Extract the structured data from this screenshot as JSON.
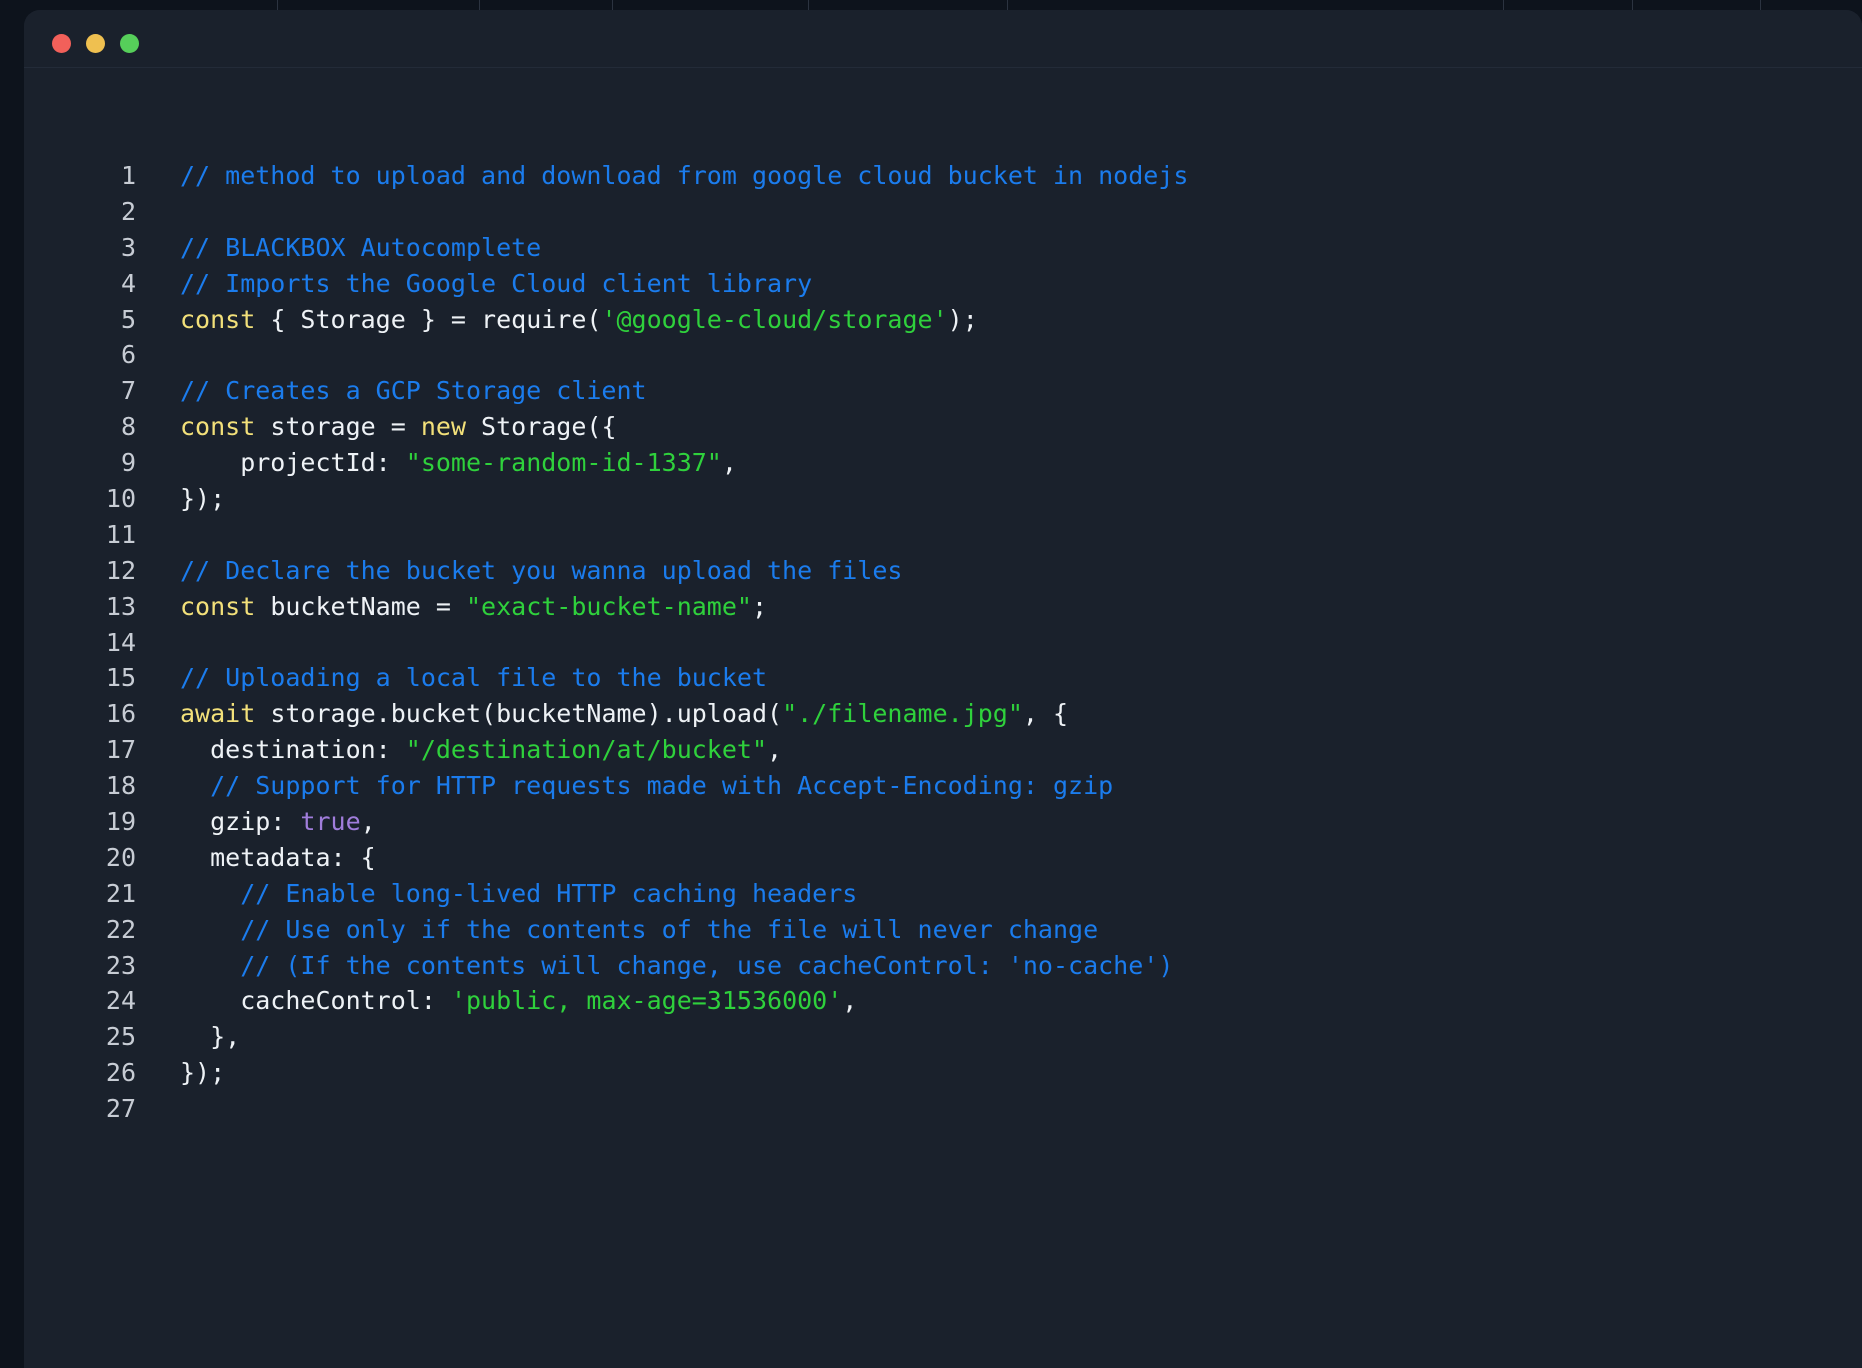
{
  "window": {
    "title": "",
    "traffic_lights": [
      {
        "name": "close",
        "color": "#f2605a"
      },
      {
        "name": "minimize",
        "color": "#efc050"
      },
      {
        "name": "maximize",
        "color": "#56cf5a"
      }
    ]
  },
  "theme": {
    "outer_background": "#0d131c",
    "window_background": "#1a212c",
    "divider": "#232b38",
    "line_number": "#c7ccd4",
    "comment": "#1b7ced",
    "keyword": "#f2e07a",
    "string": "#2fd13c",
    "boolean": "#a07ddb",
    "plain_text": "#eef2f6"
  },
  "editor": {
    "language": "javascript",
    "first_line": 1,
    "last_line": 27,
    "lines": [
      {
        "n": "1",
        "tokens": [
          {
            "t": "comment",
            "v": "// method to upload and download from google cloud bucket in nodejs"
          }
        ]
      },
      {
        "n": "2",
        "tokens": []
      },
      {
        "n": "3",
        "tokens": [
          {
            "t": "comment",
            "v": "// BLACKBOX Autocomplete"
          }
        ]
      },
      {
        "n": "4",
        "tokens": [
          {
            "t": "comment",
            "v": "// Imports the Google Cloud client library"
          }
        ]
      },
      {
        "n": "5",
        "tokens": [
          {
            "t": "kw",
            "v": "const"
          },
          {
            "t": "plain",
            "v": " { Storage } = require("
          },
          {
            "t": "str",
            "v": "'@google-cloud/storage'"
          },
          {
            "t": "plain",
            "v": ");"
          }
        ]
      },
      {
        "n": "6",
        "tokens": []
      },
      {
        "n": "7",
        "tokens": [
          {
            "t": "comment",
            "v": "// Creates a GCP Storage client"
          }
        ]
      },
      {
        "n": "8",
        "tokens": [
          {
            "t": "kw",
            "v": "const"
          },
          {
            "t": "plain",
            "v": " storage = "
          },
          {
            "t": "kw",
            "v": "new"
          },
          {
            "t": "plain",
            "v": " Storage({"
          }
        ]
      },
      {
        "n": "9",
        "tokens": [
          {
            "t": "plain",
            "v": "    projectId: "
          },
          {
            "t": "str",
            "v": "\"some-random-id-1337\""
          },
          {
            "t": "plain",
            "v": ","
          }
        ]
      },
      {
        "n": "10",
        "tokens": [
          {
            "t": "plain",
            "v": "});"
          }
        ]
      },
      {
        "n": "11",
        "tokens": []
      },
      {
        "n": "12",
        "tokens": [
          {
            "t": "comment",
            "v": "// Declare the bucket you wanna upload the files"
          }
        ]
      },
      {
        "n": "13",
        "tokens": [
          {
            "t": "kw",
            "v": "const"
          },
          {
            "t": "plain",
            "v": " bucketName = "
          },
          {
            "t": "str",
            "v": "\"exact-bucket-name\""
          },
          {
            "t": "plain",
            "v": ";"
          }
        ]
      },
      {
        "n": "14",
        "tokens": []
      },
      {
        "n": "15",
        "tokens": [
          {
            "t": "comment",
            "v": "// Uploading a local file to the bucket"
          }
        ]
      },
      {
        "n": "16",
        "tokens": [
          {
            "t": "kw",
            "v": "await"
          },
          {
            "t": "plain",
            "v": " storage.bucket(bucketName).upload("
          },
          {
            "t": "str",
            "v": "\"./filename.jpg\""
          },
          {
            "t": "plain",
            "v": ", {"
          }
        ]
      },
      {
        "n": "17",
        "tokens": [
          {
            "t": "plain",
            "v": "  destination: "
          },
          {
            "t": "str",
            "v": "\"/destination/at/bucket\""
          },
          {
            "t": "plain",
            "v": ","
          }
        ]
      },
      {
        "n": "18",
        "tokens": [
          {
            "t": "comment",
            "v": "  // Support for HTTP requests made with Accept-Encoding: gzip"
          }
        ]
      },
      {
        "n": "19",
        "tokens": [
          {
            "t": "plain",
            "v": "  gzip: "
          },
          {
            "t": "bool",
            "v": "true"
          },
          {
            "t": "plain",
            "v": ","
          }
        ]
      },
      {
        "n": "20",
        "tokens": [
          {
            "t": "plain",
            "v": "  metadata: {"
          }
        ]
      },
      {
        "n": "21",
        "tokens": [
          {
            "t": "comment",
            "v": "    // Enable long-lived HTTP caching headers"
          }
        ]
      },
      {
        "n": "22",
        "tokens": [
          {
            "t": "comment",
            "v": "    // Use only if the contents of the file will never change"
          }
        ]
      },
      {
        "n": "23",
        "tokens": [
          {
            "t": "comment",
            "v": "    // (If the contents will change, use cacheControl: 'no-cache')"
          }
        ]
      },
      {
        "n": "24",
        "tokens": [
          {
            "t": "plain",
            "v": "    cacheControl: "
          },
          {
            "t": "str",
            "v": "'public, max-age=31536000'"
          },
          {
            "t": "plain",
            "v": ","
          }
        ]
      },
      {
        "n": "25",
        "tokens": [
          {
            "t": "plain",
            "v": "  },"
          }
        ]
      },
      {
        "n": "26",
        "tokens": [
          {
            "t": "plain",
            "v": "});"
          }
        ]
      },
      {
        "n": "27",
        "tokens": []
      }
    ]
  }
}
